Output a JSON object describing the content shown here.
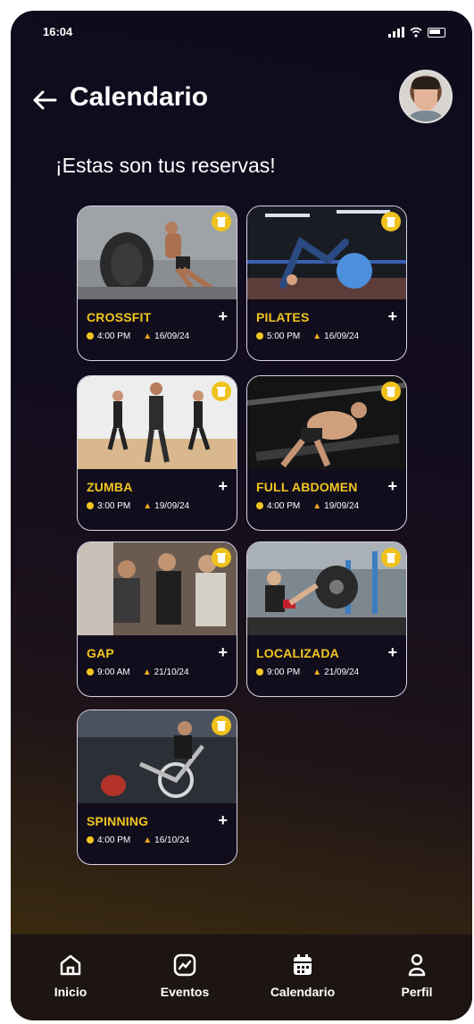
{
  "status": {
    "time": "16:04"
  },
  "header": {
    "title": "Calendario"
  },
  "subtitle": "¡Estas son tus reservas!",
  "cards": [
    {
      "name": "CROSSFIT",
      "time": "4:00 PM",
      "date": "16/09/24"
    },
    {
      "name": "PILATES",
      "time": "5:00 PM",
      "date": "16/09/24"
    },
    {
      "name": "ZUMBA",
      "time": "3:00 PM",
      "date": "19/09/24"
    },
    {
      "name": "FULL ABDOMEN",
      "time": "4:00 PM",
      "date": "19/09/24"
    },
    {
      "name": "GAP",
      "time": "9:00 AM",
      "date": "21/10/24"
    },
    {
      "name": "LOCALIZADA",
      "time": "9:00 PM",
      "date": "21/09/24"
    },
    {
      "name": "SPINNING",
      "time": "4:00 PM",
      "date": "16/10/24"
    }
  ],
  "nav": [
    {
      "label": "Inicio",
      "icon": "home-icon"
    },
    {
      "label": "Eventos",
      "icon": "chart-icon"
    },
    {
      "label": "Calendario",
      "icon": "calendar-icon"
    },
    {
      "label": "Perfil",
      "icon": "person-icon"
    }
  ],
  "colors": {
    "accent": "#f2c61f",
    "background": "#120c1f"
  }
}
